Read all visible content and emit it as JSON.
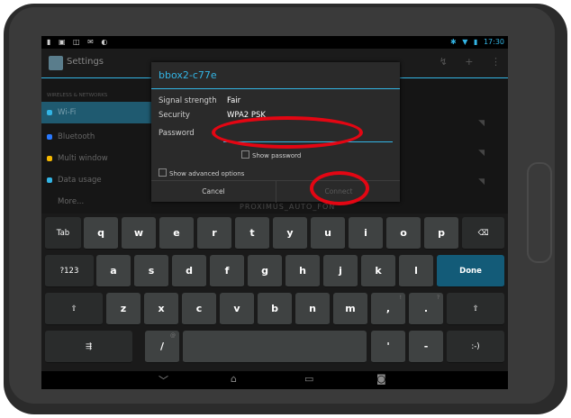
{
  "status": {
    "left_icons": "▮ ▣ ◫ ✉ ◐",
    "bt": "✱",
    "wifi": "▼",
    "battery": "▮",
    "time": "17:30"
  },
  "actionbar": {
    "title": "Settings",
    "icons": [
      "↯",
      "+",
      "⋮"
    ]
  },
  "settings": {
    "section": "WIRELESS & NETWORKS",
    "items": [
      {
        "label": "Wi-Fi",
        "color": "#33b5e5"
      },
      {
        "label": "Bluetooth",
        "color": "#2979ff"
      },
      {
        "label": "Multi window",
        "color": "#f5b800"
      },
      {
        "label": "Data usage",
        "color": "#33b5e5"
      },
      {
        "label": "More...",
        "color": ""
      }
    ],
    "behind_text": "PROXIMUS_AUTO_FON"
  },
  "dialog": {
    "title": "bbox2-c77e",
    "signal_label": "Signal strength",
    "signal_value": "Fair",
    "security_label": "Security",
    "security_value": "WPA2 PSK",
    "password_label": "Password",
    "password_value": "",
    "show_password": "Show password",
    "advanced": "Show advanced options",
    "cancel": "Cancel",
    "connect": "Connect"
  },
  "keyboard": {
    "row1": [
      "Tab",
      "q",
      "w",
      "e",
      "r",
      "t",
      "y",
      "u",
      "i",
      "o",
      "p",
      "⌫"
    ],
    "row2": [
      "?123",
      "a",
      "s",
      "d",
      "f",
      "g",
      "h",
      "j",
      "k",
      "l",
      "Done"
    ],
    "row3": [
      "⇧",
      "z",
      "x",
      "c",
      "v",
      "b",
      "n",
      "m",
      ",",
      ".",
      "⇧"
    ],
    "row4": [
      "⇶",
      "/",
      "",
      "'",
      "-",
      ":-)"
    ],
    "hints": {
      "slash": "@",
      "comma": "!",
      "period": "?"
    }
  },
  "navbar": {
    "back": "﹀",
    "home": "⌂",
    "recent": "▭",
    "screenshot": "◙"
  },
  "colors": {
    "accent": "#33b5e5",
    "annotation": "#e30613",
    "done_key": "#135b78"
  }
}
